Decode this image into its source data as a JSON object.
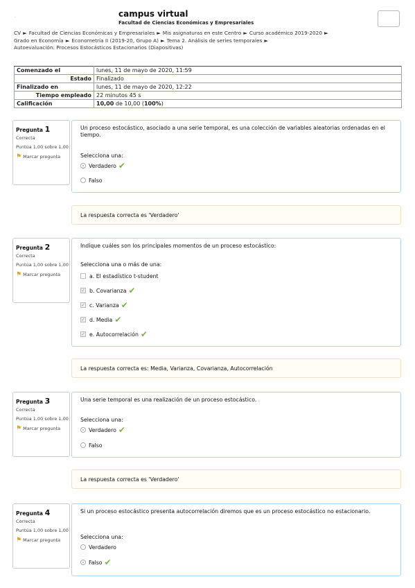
{
  "header": {
    "dot": ".",
    "title": "campus virtual",
    "subtitle": "Facultad de Ciencias Económicas y Empresariales"
  },
  "breadcrumb": {
    "line1": [
      "CV",
      "Facultad de Ciencias Económicas y Empresariales",
      "Mis asignaturas en este Centro",
      "Curso académico 2019-2020"
    ],
    "line2": [
      "Grado en Economía",
      "Econometría II (2019-20, Grupo A)",
      "Tema 2. Análisis de series temporales"
    ],
    "line3": [
      "Autoevaluación: Procesos Estocásticos Estacionarios (Diapositivas)"
    ],
    "separator": "►"
  },
  "summary": {
    "started_label": "Comenzado el",
    "started_value": "lunes, 11 de mayo de 2020, 11:59",
    "state_label": "Estado",
    "state_value": "Finalizado",
    "finished_label": "Finalizado en",
    "finished_value": "lunes, 11 de mayo de 2020, 12:22",
    "time_label": "Tiempo empleado",
    "time_value": "22 minutos 45 s",
    "grade_label": "Calificación",
    "grade_score": "10,00",
    "grade_of": "de 10,00 (",
    "grade_percent": "100%",
    "grade_close": ")"
  },
  "question_info": {
    "pregunta_label": "Pregunta",
    "state": "Correcta",
    "grade": "Puntúa 1,00 sobre 1,00",
    "flag": "Marcar pregunta"
  },
  "questions": [
    {
      "number": "1",
      "text": "Un proceso estocástico, asociado a una serie temporal, es una colección de variables aleatorias ordenadas en el tiempo.",
      "prompt": "Selecciona una:",
      "options": [
        {
          "label": "Verdadero",
          "selected": true,
          "correct_mark": true
        },
        {
          "label": "Falso",
          "selected": false,
          "correct_mark": false
        }
      ],
      "feedback": "La respuesta correcta es 'Verdadero'"
    },
    {
      "number": "2",
      "text": "Indique cuáles son los principales momentos de un proceso estocástico:",
      "prompt": "Selecciona una o más de una:",
      "options": [
        {
          "label": "a. El estadístico t-student",
          "selected": false,
          "correct_mark": false
        },
        {
          "label": "b. Covarianza",
          "selected": true,
          "correct_mark": true
        },
        {
          "label": "c. Varianza",
          "selected": true,
          "correct_mark": true
        },
        {
          "label": "d. Media",
          "selected": true,
          "correct_mark": true
        },
        {
          "label": "e. Autocorrelación",
          "selected": true,
          "correct_mark": true
        }
      ],
      "feedback": "La respuesta correcta es: Media, Varianza, Covarianza, Autocorrelación"
    },
    {
      "number": "3",
      "text": "Una serie temporal es una realización de un proceso estocástico.",
      "prompt": "Selecciona una:",
      "options": [
        {
          "label": "Verdadero",
          "selected": true,
          "correct_mark": true
        },
        {
          "label": "Falso",
          "selected": false,
          "correct_mark": false
        }
      ],
      "feedback": "La respuesta correcta es 'Verdadero'"
    },
    {
      "number": "4",
      "text": "Si un proceso estocástico presenta autocorrelación diremos que es un proceso estocástico no estacionario.",
      "prompt": "Selecciona una:",
      "options": [
        {
          "label": "Verdadero",
          "selected": false,
          "correct_mark": false
        },
        {
          "label": "Falso",
          "selected": true,
          "correct_mark": true
        }
      ]
    }
  ],
  "icons": {
    "flag": "flag-icon",
    "tick": "check-mark-icon",
    "radio": "radio-icon",
    "checkbox": "checkbox-icon"
  },
  "colors": {
    "content_border": "#b3d4ee",
    "feedback_bg": "#fffdf6",
    "feedback_border": "#f3e0c0",
    "tick": "#7cb342",
    "flag": "#e8a317"
  }
}
